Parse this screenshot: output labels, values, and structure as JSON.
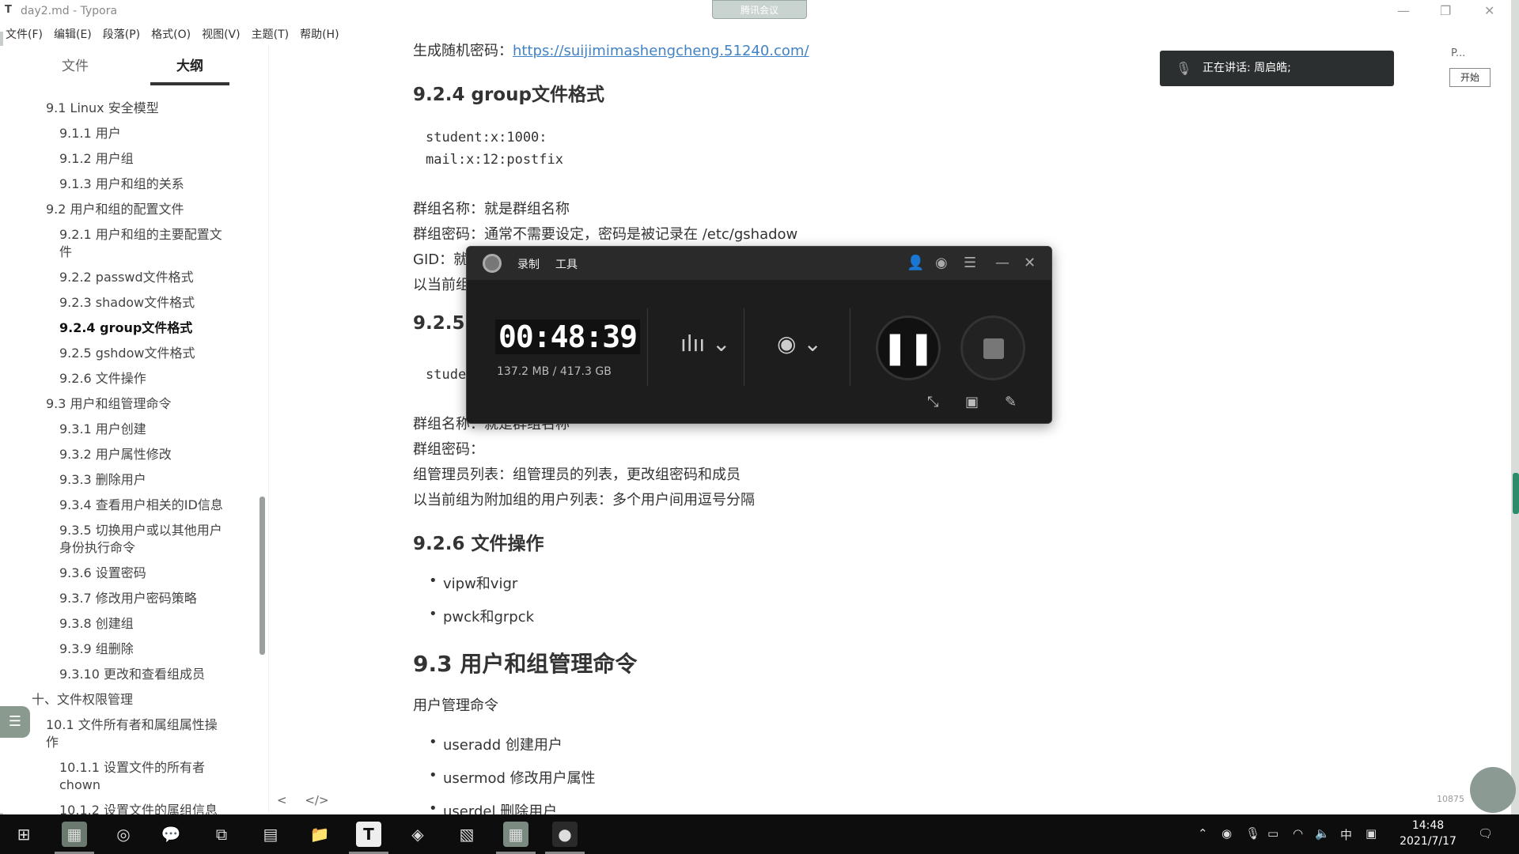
{
  "window": {
    "app_icon": "T",
    "title": "day2.md - Typora",
    "meeting_tab": "腾讯会议",
    "minimize": "—",
    "restore": "❐",
    "close": "✕"
  },
  "menu": [
    "文件(F)",
    "编辑(E)",
    "段落(P)",
    "格式(O)",
    "视图(V)",
    "主题(T)",
    "帮助(H)"
  ],
  "sidebar": {
    "tab_files": "文件",
    "tab_outline": "大纲",
    "outline": [
      {
        "label": "9.1 Linux 安全模型"
      },
      {
        "label": "9.1.1 用户"
      },
      {
        "label": "9.1.2 用户组"
      },
      {
        "label": "9.1.3 用户和组的关系"
      },
      {
        "label": "9.2 用户和组的配置文件"
      },
      {
        "label": "9.2.1 用户和组的主要配置文"
      },
      {
        "label": "件"
      },
      {
        "label": "9.2.2 passwd文件格式"
      },
      {
        "label": "9.2.3 shadow文件格式"
      },
      {
        "label": "9.2.4 group文件格式"
      },
      {
        "label": "9.2.5 gshdow文件格式"
      },
      {
        "label": "9.2.6 文件操作"
      },
      {
        "label": "9.3 用户和组管理命令"
      },
      {
        "label": "9.3.1 用户创建"
      },
      {
        "label": "9.3.2 用户属性修改"
      },
      {
        "label": "9.3.3 删除用户"
      },
      {
        "label": "9.3.4 查看用户相关的ID信息"
      },
      {
        "label": "9.3.5 切换用户或以其他用户"
      },
      {
        "label": "身份执行命令"
      },
      {
        "label": "9.3.6 设置密码"
      },
      {
        "label": "9.3.7 修改用户密码策略"
      },
      {
        "label": "9.3.8 创建组"
      },
      {
        "label": "9.3.9 组删除"
      },
      {
        "label": "9.3.10 更改和查看组成员"
      },
      {
        "label": "十、文件权限管理"
      },
      {
        "label": "10.1 文件所有者和属组属性操"
      },
      {
        "label": "作"
      },
      {
        "label": "10.1.1 设置文件的所有者"
      },
      {
        "label": "chown"
      },
      {
        "label": "10.1.2 设置文件的属组信息"
      }
    ],
    "bottom_back": "<",
    "bottom_source": "</>"
  },
  "content": {
    "random_pw_label": "生成随机密码：",
    "random_pw_link": "https://suijimimashengcheng.51240.com/",
    "h_924": "9.2.4 group文件格式",
    "code_line1": "student:x:1000:",
    "code_line2": "mail:x:12:postfix",
    "p_group_name": "群组名称：就是群组名称",
    "p_group_pw": "群组密码：通常不需要设定，密码是被记录在 /etc/gshadow",
    "p_gid": "GID：就",
    "p_current": "以当前组",
    "h_925": "9.2.5 g",
    "code_stude": "stude",
    "p_group_name2": "群组名称：就是群组名称",
    "p_group_pw2": "群组密码：",
    "p_admin_list": "组管理员列表：组管理员的列表，更改组密码和成员",
    "p_member_list": "以当前组为附加组的用户列表：多个用户间用逗号分隔",
    "h_926": "9.2.6 文件操作",
    "li_vipw": "vipw和vigr",
    "li_pwck": "pwck和grpck",
    "h_93": "9.3 用户和组管理命令",
    "p_user_cmds": "用户管理命令",
    "li_useradd": "useradd 创建用户",
    "li_usermod": "usermod 修改用户属性",
    "li_userdel": "userdel 删除用户"
  },
  "recorder": {
    "tab_record": "录制",
    "tab_tools": "工具",
    "timer": "00:48:39",
    "storage": "137.2 MB / 417.3 GB",
    "pause_glyph": "❚❚"
  },
  "speaking": {
    "text": "正在讲话: 周启皓;",
    "p_label": "P...",
    "start_button": "开始"
  },
  "side_counter": "10875",
  "taskbar": {
    "tray_lang": "中",
    "time": "14:48",
    "date": "2021/7/17"
  }
}
